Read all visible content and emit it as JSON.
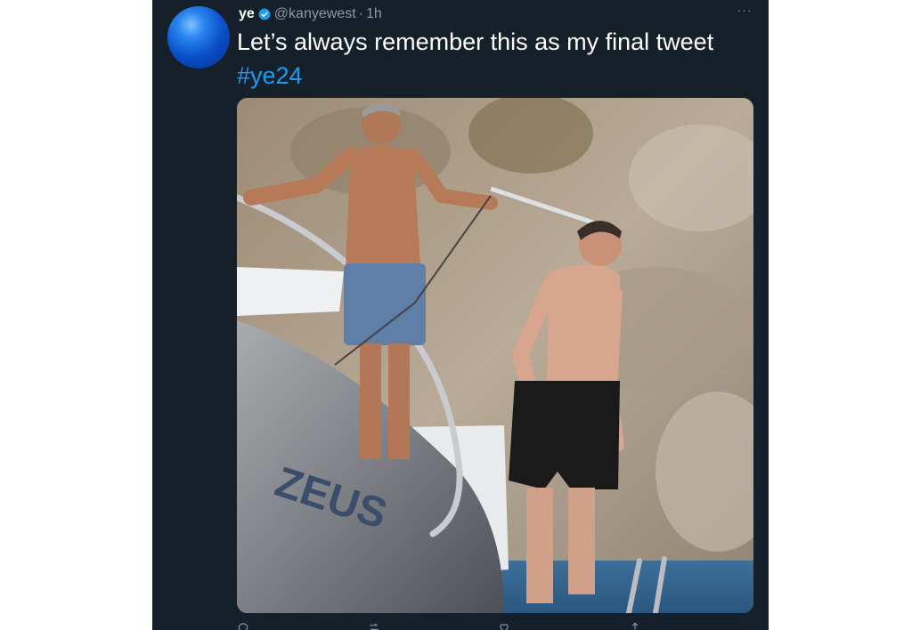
{
  "author": {
    "display_name": "ye",
    "handle": "@kanyewest",
    "separator": "·",
    "time": "1h",
    "verified_color": "#1d9bf0",
    "avatar_icon": "blue-orb-avatar"
  },
  "tweet": {
    "text": "Let’s always remember this as my final tweet ",
    "hashtag": "#ye24",
    "media_alt": "Two shirtless men on a yacht named ZEUS, one spraying the other with a shower hose"
  },
  "more_icon": "···",
  "colors": {
    "background": "#15202b",
    "text": "#ffffff",
    "secondary": "#8b98a5",
    "accent": "#1d9bf0"
  },
  "actions": {
    "reply_icon": "reply-icon",
    "retweet_icon": "retweet-icon",
    "like_icon": "like-icon",
    "share_icon": "share-icon"
  }
}
